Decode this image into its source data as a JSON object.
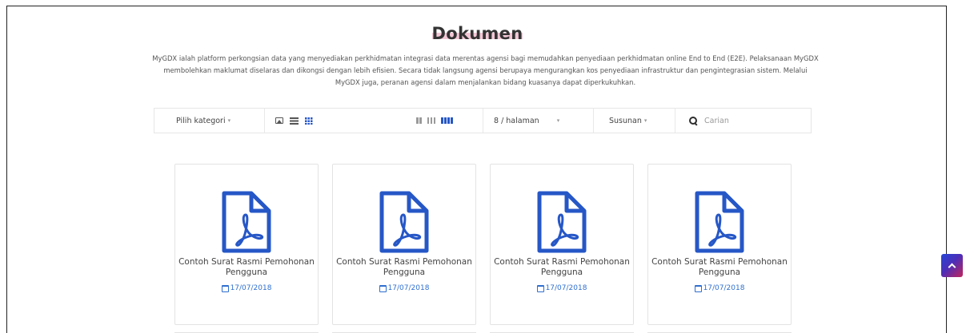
{
  "page": {
    "title": "Dokumen",
    "description": "MyGDX ialah platform perkongsian data yang menyediakan perkhidmatan integrasi data merentas agensi bagi memudahkan penyediaan perkhidmatan online End to End (E2E). Pelaksanaan MyGDX membolehkan maklumat diselaras dan dikongsi dengan lebih efisien. Secara tidak langsung agensi berupaya mengurangkan kos penyediaan infrastruktur dan pengintegrasian sistem. Melalui MyGDX juga, peranan agensi dalam menjalankan bidang kuasanya dapat diperkukuhkan."
  },
  "toolbar": {
    "category_label": "Pilih kategori",
    "view_icons": [
      "image-icon",
      "list-icon",
      "grid-icon"
    ],
    "active_view": "grid-icon",
    "column_options": [
      2,
      3,
      4
    ],
    "active_columns": 4,
    "per_page": "8 / halaman",
    "sort_label": "Susunan",
    "search_placeholder": "Carian"
  },
  "documents": [
    {
      "title": "Contoh Surat Rasmi Pemohonan Pengguna",
      "date": "17/07/2018",
      "icon": "pdf-icon"
    },
    {
      "title": "Contoh Surat Rasmi Pemohonan Pengguna",
      "date": "17/07/2018",
      "icon": "pdf-icon"
    },
    {
      "title": "Contoh Surat Rasmi Pemohonan Pengguna",
      "date": "17/07/2018",
      "icon": "pdf-icon"
    },
    {
      "title": "Contoh Surat Rasmi Pemohonan Pengguna",
      "date": "17/07/2018",
      "icon": "pdf-icon"
    }
  ],
  "colors": {
    "accent": "#2657c7",
    "date_text": "#2f6fcf",
    "scroll_button_start": "#2646d6",
    "scroll_button_end": "#c2255a"
  },
  "scroll_top_icon": "chevron-up-icon"
}
